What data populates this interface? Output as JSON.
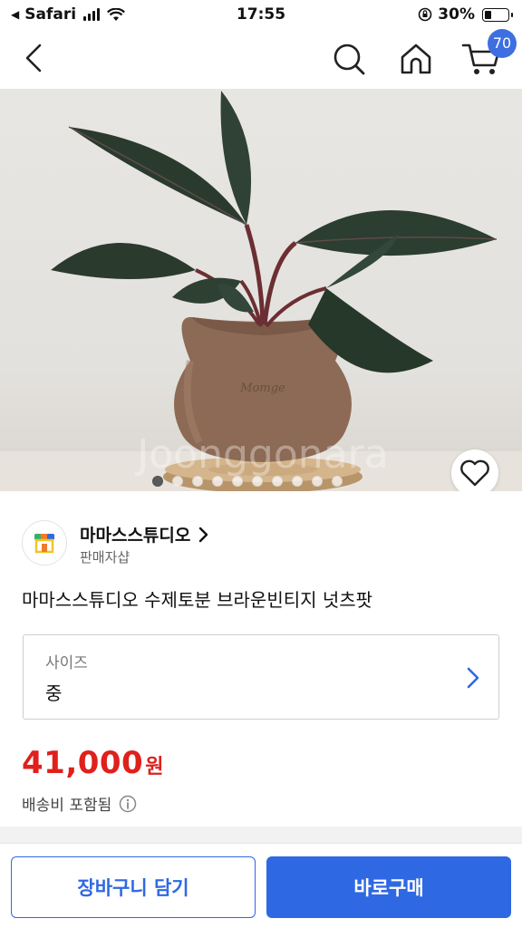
{
  "status_bar": {
    "carrier": "Safari",
    "time": "17:55",
    "battery": "30%",
    "battery_level": 0.3
  },
  "header": {
    "cart_count": "70",
    "accent": "#3d6fe0"
  },
  "hero": {
    "watermark": "Joonggonara",
    "slide_count": 10,
    "active_slide": 1
  },
  "seller": {
    "name": "마마스스튜디오",
    "subtitle": "판매자샵"
  },
  "product": {
    "title": "마마스스튜디오 수제토분 브라운빈티지 넛츠팟"
  },
  "option": {
    "label": "사이즈",
    "value": "중"
  },
  "price": {
    "amount": "41,000",
    "unit": "원",
    "color": "#e0201c"
  },
  "shipping": {
    "text": "배송비 포함됨"
  },
  "actions": {
    "add_to_cart": "장바구니 담기",
    "buy_now": "바로구매",
    "primary_color": "#2f68e3"
  }
}
